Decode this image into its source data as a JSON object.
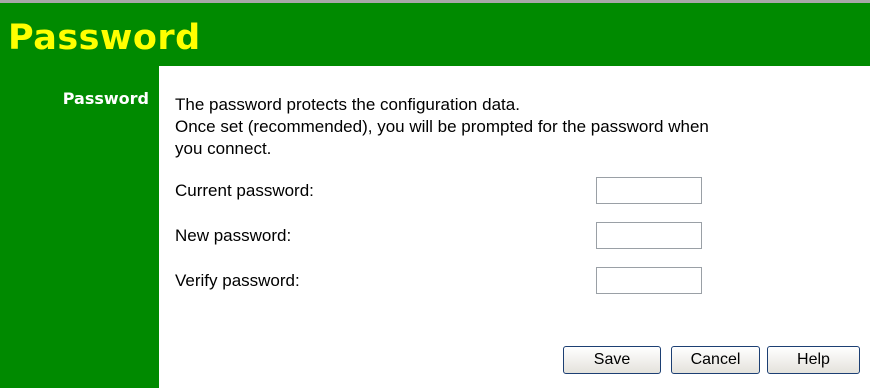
{
  "page": {
    "title": "Password"
  },
  "sidebar": {
    "section_label": "Password"
  },
  "description": {
    "lines": [
      "The password protects the configuration data.",
      "Once set (recommended), you will be prompted for the password when",
      "you connect."
    ]
  },
  "form": {
    "current_password": {
      "label": "Current password:",
      "value": ""
    },
    "new_password": {
      "label": "New password:",
      "value": ""
    },
    "verify_password": {
      "label": "Verify password:",
      "value": ""
    }
  },
  "buttons": {
    "save": "Save",
    "cancel": "Cancel",
    "help": "Help"
  },
  "colors": {
    "header_bg": "#008a00",
    "title_text": "#ffff00",
    "sidebar_text": "#ffffff"
  }
}
